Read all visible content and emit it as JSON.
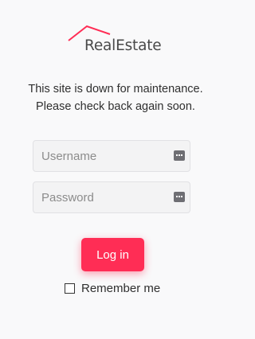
{
  "brand": {
    "name": "RealEstate",
    "accent_color": "#ff2d55",
    "logo_icon": "roof-icon"
  },
  "notice": {
    "line1": "This site is down for maintenance.",
    "line2": "Please check back again soon."
  },
  "form": {
    "username_placeholder": "Username",
    "username_value": "",
    "password_placeholder": "Password",
    "password_value": "",
    "field_icon": "password-manager-icon",
    "login_label": "Log in",
    "remember_label": "Remember me",
    "remember_checked": false
  }
}
